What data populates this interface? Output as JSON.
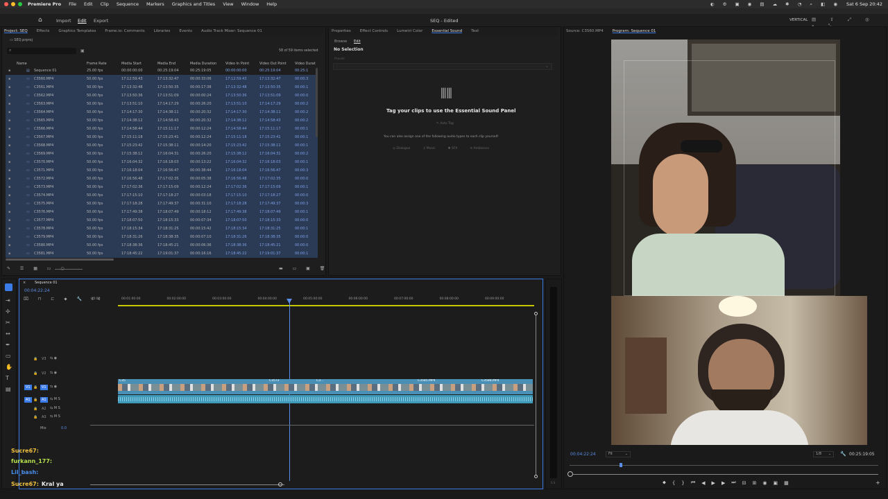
{
  "menubar": {
    "apple": "",
    "items": [
      "Premiere Pro",
      "File",
      "Edit",
      "Clip",
      "Sequence",
      "Markers",
      "Graphics and Titles",
      "View",
      "Window",
      "Help"
    ],
    "clock": "Sat 6 Sep  20:42"
  },
  "apptop": {
    "tabs": [
      "Import",
      "Edit",
      "Export"
    ],
    "title": "SEQ - Edited",
    "workspace": "VERTICAL"
  },
  "project": {
    "tabs": [
      "Project: SEQ",
      "Effects",
      "Graphics Templates",
      "Frame.io: Comments",
      "Libraries",
      "Events",
      "Audio Track Mixer: Sequence 01"
    ],
    "file": "SEQ.prproj",
    "selected_count": "58 of 59 items selected",
    "columns": [
      "Name",
      "Frame Rate",
      "Media Start",
      "Media End",
      "Media Duration",
      "Video In Point",
      "Video Out Point",
      "Video Durat"
    ],
    "rows": [
      [
        "Sequence 01",
        "25.00 fps",
        "00:00:00:00",
        "00:25:19:04",
        "00:25:19:05",
        "00:00:00:00",
        "00:25:19:04",
        "00:25:1"
      ],
      [
        "C3560.MP4",
        "50.00 fps",
        "17:12:59:43",
        "17:13:32:47",
        "00:00:33:06",
        "17:12:59:43",
        "17:13:32:47",
        "00:00:3"
      ],
      [
        "C3561.MP4",
        "50.00 fps",
        "17:13:32:48",
        "17:13:50:35",
        "00:00:17:38",
        "17:13:32:48",
        "17:13:50:35",
        "00:00:1"
      ],
      [
        "C3562.MP4",
        "50.00 fps",
        "17:13:50:36",
        "17:13:51:09",
        "00:00:00:24",
        "17:13:50:36",
        "17:13:51:09",
        "00:00:0"
      ],
      [
        "C3563.MP4",
        "50.00 fps",
        "17:13:51:10",
        "17:14:17:29",
        "00:00:26:20",
        "17:13:51:10",
        "17:14:17:29",
        "00:00:2"
      ],
      [
        "C3564.MP4",
        "50.00 fps",
        "17:14:17:30",
        "17:14:38:11",
        "00:00:20:32",
        "17:14:17:30",
        "17:14:38:11",
        "00:00:2"
      ],
      [
        "C3565.MP4",
        "50.00 fps",
        "17:14:38:12",
        "17:14:58:43",
        "00:00:20:32",
        "17:14:38:12",
        "17:14:58:43",
        "00:00:2"
      ],
      [
        "C3566.MP4",
        "50.00 fps",
        "17:14:58:44",
        "17:15:11:17",
        "00:00:12:24",
        "17:14:58:44",
        "17:15:11:17",
        "00:00:1"
      ],
      [
        "C3567.MP4",
        "50.00 fps",
        "17:15:11:18",
        "17:15:23:41",
        "00:00:12:24",
        "17:15:11:18",
        "17:15:23:41",
        "00:00:1"
      ],
      [
        "C3568.MP4",
        "50.00 fps",
        "17:15:23:42",
        "17:15:38:11",
        "00:00:14:20",
        "17:15:23:42",
        "17:15:38:11",
        "00:00:1"
      ],
      [
        "C3569.MP4",
        "50.00 fps",
        "17:15:38:12",
        "17:16:04:31",
        "00:00:26:20",
        "17:15:38:12",
        "17:16:04:31",
        "00:00:2"
      ],
      [
        "C3570.MP4",
        "50.00 fps",
        "17:16:04:32",
        "17:16:18:03",
        "00:00:13:22",
        "17:16:04:32",
        "17:16:18:03",
        "00:00:1"
      ],
      [
        "C3571.MP4",
        "50.00 fps",
        "17:16:18:04",
        "17:16:56:47",
        "00:00:38:44",
        "17:16:18:04",
        "17:16:56:47",
        "00:00:3"
      ],
      [
        "C3572.MP4",
        "50.00 fps",
        "17:16:56:48",
        "17:17:02:35",
        "00:00:05:38",
        "17:16:56:48",
        "17:17:02:35",
        "00:00:0"
      ],
      [
        "C3573.MP4",
        "50.00 fps",
        "17:17:02:36",
        "17:17:15:09",
        "00:00:12:24",
        "17:17:02:36",
        "17:17:15:09",
        "00:00:1"
      ],
      [
        "C3574.MP4",
        "50.00 fps",
        "17:17:15:10",
        "17:17:18:27",
        "00:00:03:18",
        "17:17:15:10",
        "17:17:18:27",
        "00:00:0"
      ],
      [
        "C3575.MP4",
        "50.00 fps",
        "17:17:18:28",
        "17:17:49:37",
        "00:00:31:10",
        "17:17:18:28",
        "17:17:49:37",
        "00:00:3"
      ],
      [
        "C3576.MP4",
        "50.00 fps",
        "17:17:49:38",
        "17:18:07:49",
        "00:00:18:12",
        "17:17:49:38",
        "17:18:07:49",
        "00:00:1"
      ],
      [
        "C3577.MP4",
        "50.00 fps",
        "17:18:07:50",
        "17:18:15:33",
        "00:00:07:34",
        "17:18:07:50",
        "17:18:15:33",
        "00:00:0"
      ],
      [
        "C3578.MP4",
        "50.00 fps",
        "17:18:15:34",
        "17:18:31:25",
        "00:00:15:42",
        "17:18:15:34",
        "17:18:31:25",
        "00:00:1"
      ],
      [
        "C3579.MP4",
        "50.00 fps",
        "17:18:31:26",
        "17:18:38:35",
        "00:00:07:10",
        "17:18:31:26",
        "17:18:38:35",
        "00:00:0"
      ],
      [
        "C3580.MP4",
        "50.00 fps",
        "17:18:38:36",
        "17:18:45:21",
        "00:00:06:36",
        "17:18:38:36",
        "17:18:45:21",
        "00:00:0"
      ],
      [
        "C3581.MP4",
        "50.00 fps",
        "17:18:45:22",
        "17:19:01:37",
        "00:00:16:16",
        "17:18:45:22",
        "17:19:01:37",
        "00:00:1"
      ]
    ]
  },
  "essential": {
    "tabs": [
      "Properties",
      "Effect Controls",
      "Lumetri Color",
      "Essential Sound",
      "Text"
    ],
    "subtabs": [
      "Browse",
      "Edit"
    ],
    "no_selection": "No Selection",
    "preset": "Preset:",
    "heading": "Tag your clips to use the Essential Sound Panel",
    "auto_tag": "Auto Tag",
    "assign": "You can also assign one of the following audio types to each clip yourself:",
    "types": [
      "Dialogue",
      "Music",
      "SFX",
      "Ambience"
    ]
  },
  "monitor": {
    "tabs": [
      "Source: C3560.MP4",
      "Program: Sequence 01"
    ],
    "timecode": "00:04:22:24",
    "fit": "Fit",
    "res": "1/8",
    "duration": "00:25:19:05"
  },
  "timeline": {
    "name": "Sequence 01",
    "timecode": "00:04:22:24",
    "ruler": [
      ":00:00",
      "00:01:00:00",
      "00:02:00:00",
      "00:03:00:00",
      "00:04:00:00",
      "00:05:00:00",
      "00:06:00:00",
      "00:07:00:00",
      "00:08:00:00",
      "00:09:00:00"
    ],
    "tracks": [
      "V3",
      "V2",
      "V1",
      "A1",
      "A2",
      "A3"
    ],
    "mix": "Mix",
    "mix_val": "0.0",
    "clip_labels": [
      "C35",
      "C3572",
      "C3...",
      "C3585.MP4",
      "C3588.MP4"
    ]
  },
  "chat": [
    {
      "user": "Sucre67:",
      "msg": "",
      "color": "#f0c040"
    },
    {
      "user": "furkann_177:",
      "msg": "",
      "color": "#b6e04a"
    },
    {
      "user": "Lil_bash:",
      "msg": "",
      "color": "#4a8ff0"
    },
    {
      "user": "Sucre67:",
      "msg": "Kral ya",
      "color": "#f0c040"
    }
  ],
  "colors": {
    "accent": "#3b7be8",
    "clip_video": "#4a8fb5",
    "clip_audio": "#3e9ab8",
    "playhead": "#5b8ee6"
  }
}
